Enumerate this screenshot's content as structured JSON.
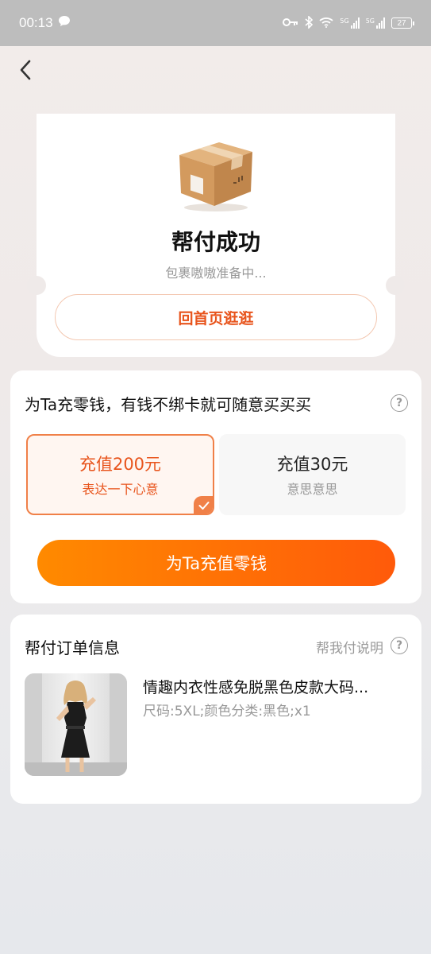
{
  "status_bar": {
    "time": "00:13",
    "battery": "27",
    "network_1": "5G",
    "network_2": "5G",
    "icons": [
      "chat-bubble-icon",
      "key-icon",
      "bluetooth-icon",
      "wifi-icon",
      "signal-icon",
      "signal-icon",
      "battery-icon"
    ]
  },
  "nav": {
    "back_icon": "chevron-left-icon"
  },
  "success": {
    "icon": "package-box-icon",
    "title": "帮付成功",
    "subtitle": "包裹嗷嗷准备中...",
    "home_button": "回首页逛逛"
  },
  "topup": {
    "title": "为Ta充零钱，有钱不绑卡就可随意买买买",
    "help_icon": "question-circle-icon",
    "options": [
      {
        "amount": "充值200元",
        "desc": "表达一下心意",
        "selected": true
      },
      {
        "amount": "充值30元",
        "desc": "意思意思",
        "selected": false
      }
    ],
    "selected_check_icon": "check-icon",
    "button": "为Ta充值零钱"
  },
  "order": {
    "title": "帮付订单信息",
    "help_link": "帮我付说明",
    "help_icon": "question-circle-icon",
    "product": {
      "name": "情趣内衣性感免脱黑色皮款大码...",
      "spec": "尺码:5XL;颜色分类:黑色;x1",
      "image": "product-photo"
    }
  },
  "colors": {
    "accent": "#e8541c",
    "button_gradient_start": "#ff8a00",
    "button_gradient_end": "#ff5a0a",
    "status_bar": "#bdbdbd"
  }
}
